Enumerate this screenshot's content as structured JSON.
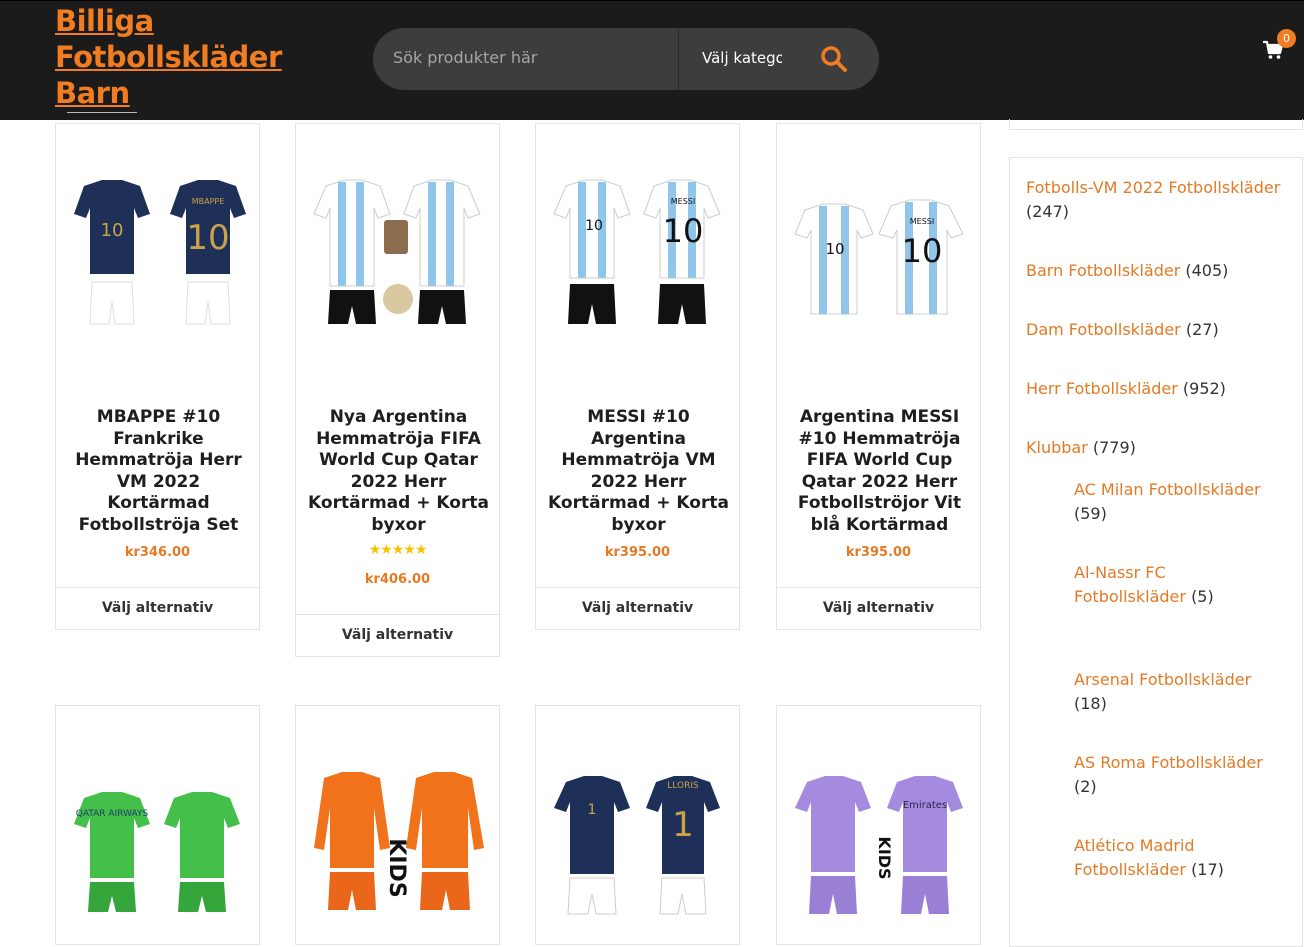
{
  "header": {
    "logo_line1": "Billiga",
    "logo_line2": "Fotbollskläder",
    "logo_line3": "Barn",
    "search_placeholder": "Sök produkter här",
    "category_select": "Välj kategori",
    "cart_count": "0",
    "accent_color": "#f07d22"
  },
  "products": [
    {
      "title": "MBAPPE #10 Frankrike Hemmatröja Herr VM 2022 Kortärmad Fotbollströja Set",
      "price": "kr346.00",
      "button": "Välj alternativ"
    },
    {
      "title": "Nya Argentina Hemmatröja FIFA World Cup Qatar 2022 Herr Kortärmad + Korta byxor",
      "rating": "★★★★★",
      "price": "kr406.00",
      "button": "Välj alternativ"
    },
    {
      "title": "MESSI #10 Argentina Hemmatröja VM 2022 Herr Kortärmad + Korta byxor",
      "price": "kr395.00",
      "button": "Välj alternativ"
    },
    {
      "title": "Argentina MESSI #10 Hemmatröja FIFA World Cup Qatar 2022 Herr Fotbollströjor Vit blå Kortärmad",
      "price": "kr395.00",
      "button": "Välj alternativ"
    }
  ],
  "product_images": [
    {
      "label_front": "10",
      "label_back": "MBAPPE",
      "number_back": "10"
    },
    {
      "label_front": "",
      "label_back": "",
      "number_back": ""
    },
    {
      "label_front": "10",
      "label_back": "MESSI",
      "number_back": "10"
    },
    {
      "label_front": "10",
      "label_back": "MESSI",
      "number_back": "10"
    },
    {
      "label_front": "QATAR AIRWAYS",
      "label_back": "",
      "number_back": ""
    },
    {
      "label_front": "",
      "label_back": "KIDS",
      "number_back": ""
    },
    {
      "label_front": "1",
      "label_back": "LLORIS",
      "number_back": "1"
    },
    {
      "label_front": "",
      "label_back": "Emirates",
      "number_back": "KIDS"
    }
  ],
  "sidebar": {
    "categories": [
      {
        "label": "Fotbolls-VM 2022 Fotbollskläder",
        "count": "(247)"
      },
      {
        "label": "Barn Fotbollskläder",
        "count": "(405)"
      },
      {
        "label": "Dam Fotbollskläder",
        "count": "(27)"
      },
      {
        "label": "Herr Fotbollskläder",
        "count": "(952)"
      },
      {
        "label": "Klubbar",
        "count": "(779)"
      }
    ],
    "subcategories": [
      {
        "label": "AC Milan Fotbollskläder",
        "count": "(59)"
      },
      {
        "label": "Al-Nassr FC Fotbollskläder",
        "count": "(5)"
      },
      {
        "label": "Arsenal Fotbollskläder",
        "count": "(18)"
      },
      {
        "label": "AS Roma Fotbollskläder",
        "count": "(2)"
      },
      {
        "label": "Atlético Madrid Fotbollskläder",
        "count": "(17)"
      }
    ]
  }
}
